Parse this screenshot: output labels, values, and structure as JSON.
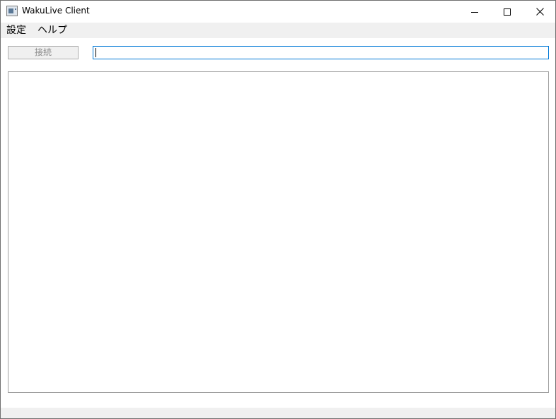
{
  "window": {
    "title": "WakuLive Client"
  },
  "menubar": {
    "items": [
      {
        "label": "設定"
      },
      {
        "label": "ヘルプ"
      }
    ]
  },
  "toolbar": {
    "connect_label": "接続",
    "url_value": "",
    "url_placeholder": ""
  },
  "icons": {
    "app": "app-window-icon",
    "minimize": "minimize-icon",
    "maximize": "maximize-icon",
    "close": "close-icon"
  },
  "colors": {
    "input_focus_border": "#0078d7",
    "menubar_bg": "#f0f0f0",
    "disabled_text": "#8c8c8c"
  }
}
